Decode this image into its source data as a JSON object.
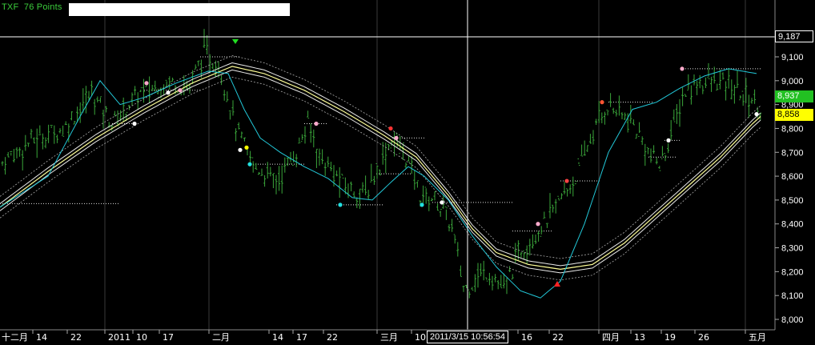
{
  "header": {
    "symbol": "TXF",
    "points_label": "76 Points"
  },
  "price_axis": {
    "ticks": [
      "9,100",
      "9,000",
      "8,900",
      "8,800",
      "8,700",
      "8,600",
      "8,500",
      "8,400",
      "8,300",
      "8,200",
      "8,100",
      "8,000"
    ]
  },
  "badges": {
    "crosshair_price": "9,187",
    "last_price": "8,937",
    "band_price": "8,858"
  },
  "time_axis": {
    "labels": [
      "十二月",
      "14",
      "22",
      "2011",
      "10",
      "17",
      "二月",
      "14",
      "17",
      "22",
      "三月",
      "10",
      "16",
      "22",
      "四月",
      "13",
      "19",
      "26",
      "五月"
    ],
    "crosshair_time": "2011/3/15 10:56:54"
  },
  "colors": {
    "background": "#000000",
    "bars": "#3aa63a",
    "fast_ma": "#22c8d8",
    "band_center": "#ffff99",
    "band_edge": "#e8e8e8",
    "grid": "#3a3a3a",
    "crosshair": "#ffffff",
    "title_text": "#3ccd3c"
  }
}
